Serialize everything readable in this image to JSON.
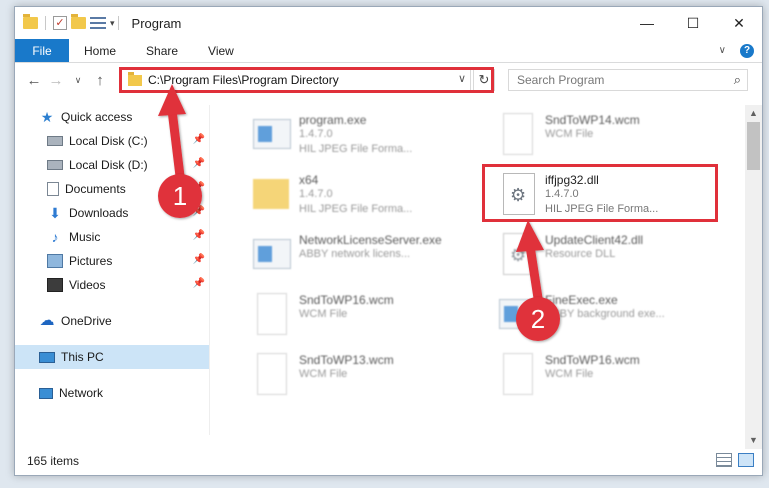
{
  "window": {
    "title": "Program",
    "controls": {
      "minimize": "—",
      "maximize": "☐",
      "close": "✕"
    }
  },
  "ribbon": {
    "tabs": [
      "File",
      "Home",
      "Share",
      "View"
    ],
    "expand": "∨",
    "help": "?"
  },
  "nav": {
    "back": "←",
    "forward": "→",
    "recent": "∨",
    "up": "↑",
    "address": "C:\\Program Files\\Program Directory",
    "address_dropdown": "∨",
    "refresh": "↻",
    "search_placeholder": "Search Program"
  },
  "sidebar": {
    "quick_access": "Quick access",
    "pinned": [
      {
        "label": "Local Disk (C:)",
        "icon": "disk-icon"
      },
      {
        "label": "Local Disk (D:)",
        "icon": "disk-icon"
      },
      {
        "label": "Documents",
        "icon": "documents-icon"
      },
      {
        "label": "Downloads",
        "icon": "downloads-icon"
      },
      {
        "label": "Music",
        "icon": "music-icon"
      },
      {
        "label": "Pictures",
        "icon": "pictures-icon"
      },
      {
        "label": "Videos",
        "icon": "videos-icon"
      }
    ],
    "onedrive": "OneDrive",
    "this_pc": "This PC",
    "network": "Network"
  },
  "files": [
    {
      "name": "program.exe",
      "line1": "1.4.7.0",
      "line2": "HIL JPEG File Forma...",
      "type": "exe",
      "blurred": true
    },
    {
      "name": "SndToWP14.wcm",
      "line1": "WCM File",
      "line2": "",
      "type": "page",
      "blurred": true
    },
    {
      "name": "x64",
      "line1": "1.4.7.0",
      "line2": "HIL JPEG File Forma...",
      "type": "folder",
      "blurred": true
    },
    {
      "name": "iffjpg32.dll",
      "line1": "1.4.7.0",
      "line2": "HIL JPEG File Forma...",
      "type": "dll",
      "blurred": false
    },
    {
      "name": "NetworkLicenseServer.exe",
      "line1": "ABBY network licens...",
      "line2": "",
      "type": "exe",
      "blurred": true
    },
    {
      "name": "UpdateClient42.dll",
      "line1": "Resource DLL",
      "line2": "",
      "type": "dll",
      "blurred": true
    },
    {
      "name": "SndToWP16.wcm",
      "line1": "WCM File",
      "line2": "",
      "type": "page",
      "blurred": true
    },
    {
      "name": "FineExec.exe",
      "line1": "ABBY background exe...",
      "line2": "",
      "type": "exe",
      "blurred": true
    },
    {
      "name": "SndToWP13.wcm",
      "line1": "WCM File",
      "line2": "",
      "type": "page",
      "blurred": true
    },
    {
      "name": "SndToWP16.wcm",
      "line1": "WCM File",
      "line2": "",
      "type": "page",
      "blurred": true
    }
  ],
  "status": {
    "item_count": "165 items"
  },
  "annotations": {
    "step1": "1",
    "step2": "2",
    "color": "#e0303a"
  }
}
